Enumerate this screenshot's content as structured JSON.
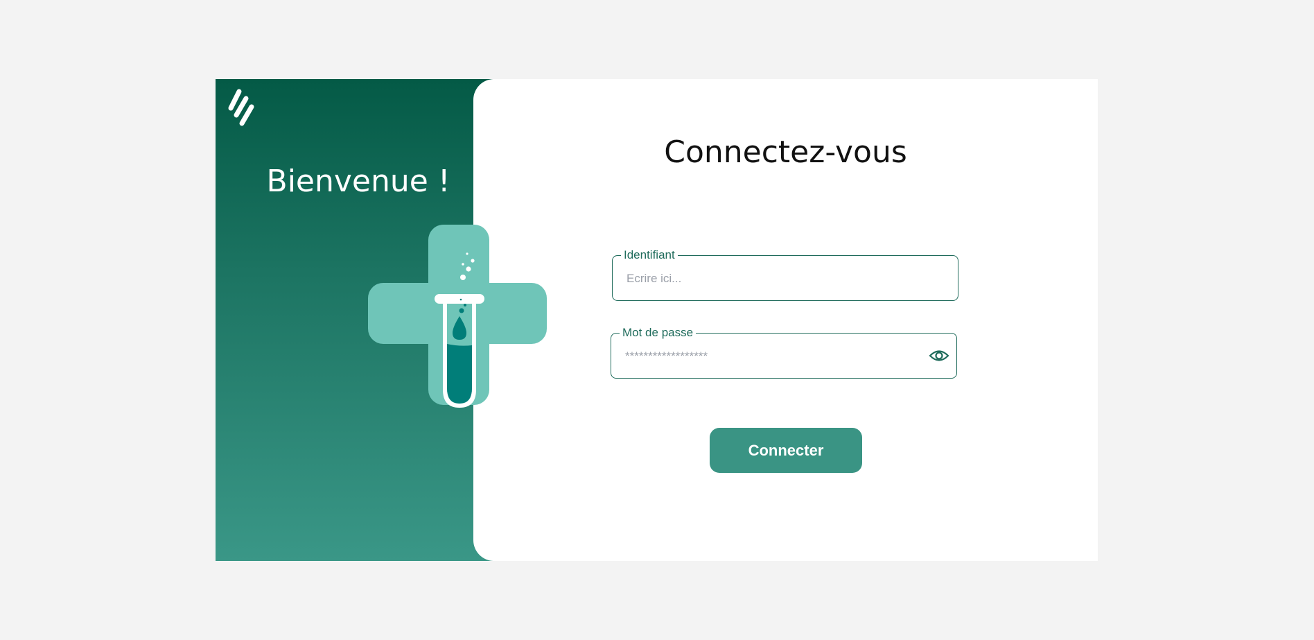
{
  "welcome": {
    "title": "Bienvenue !",
    "logo_icon": "logo-stripes-icon",
    "illustration_icon": "medical-cross-test-tube-icon"
  },
  "login": {
    "title": "Connectez-vous",
    "username": {
      "label": "Identifiant",
      "placeholder": "Ecrire ici...",
      "value": ""
    },
    "password": {
      "label": "Mot de passe",
      "placeholder": "******************",
      "value": "",
      "toggle_icon": "eye-icon"
    },
    "submit_label": "Connecter"
  },
  "colors": {
    "page_bg": "#f3f3f3",
    "panel_gradient_top": "#045a46",
    "panel_gradient_bottom": "#3a9787",
    "accent": "#1f6b5b",
    "button": "#3a9484",
    "cross": "#6fc5b8",
    "liquid": "#017e79"
  }
}
